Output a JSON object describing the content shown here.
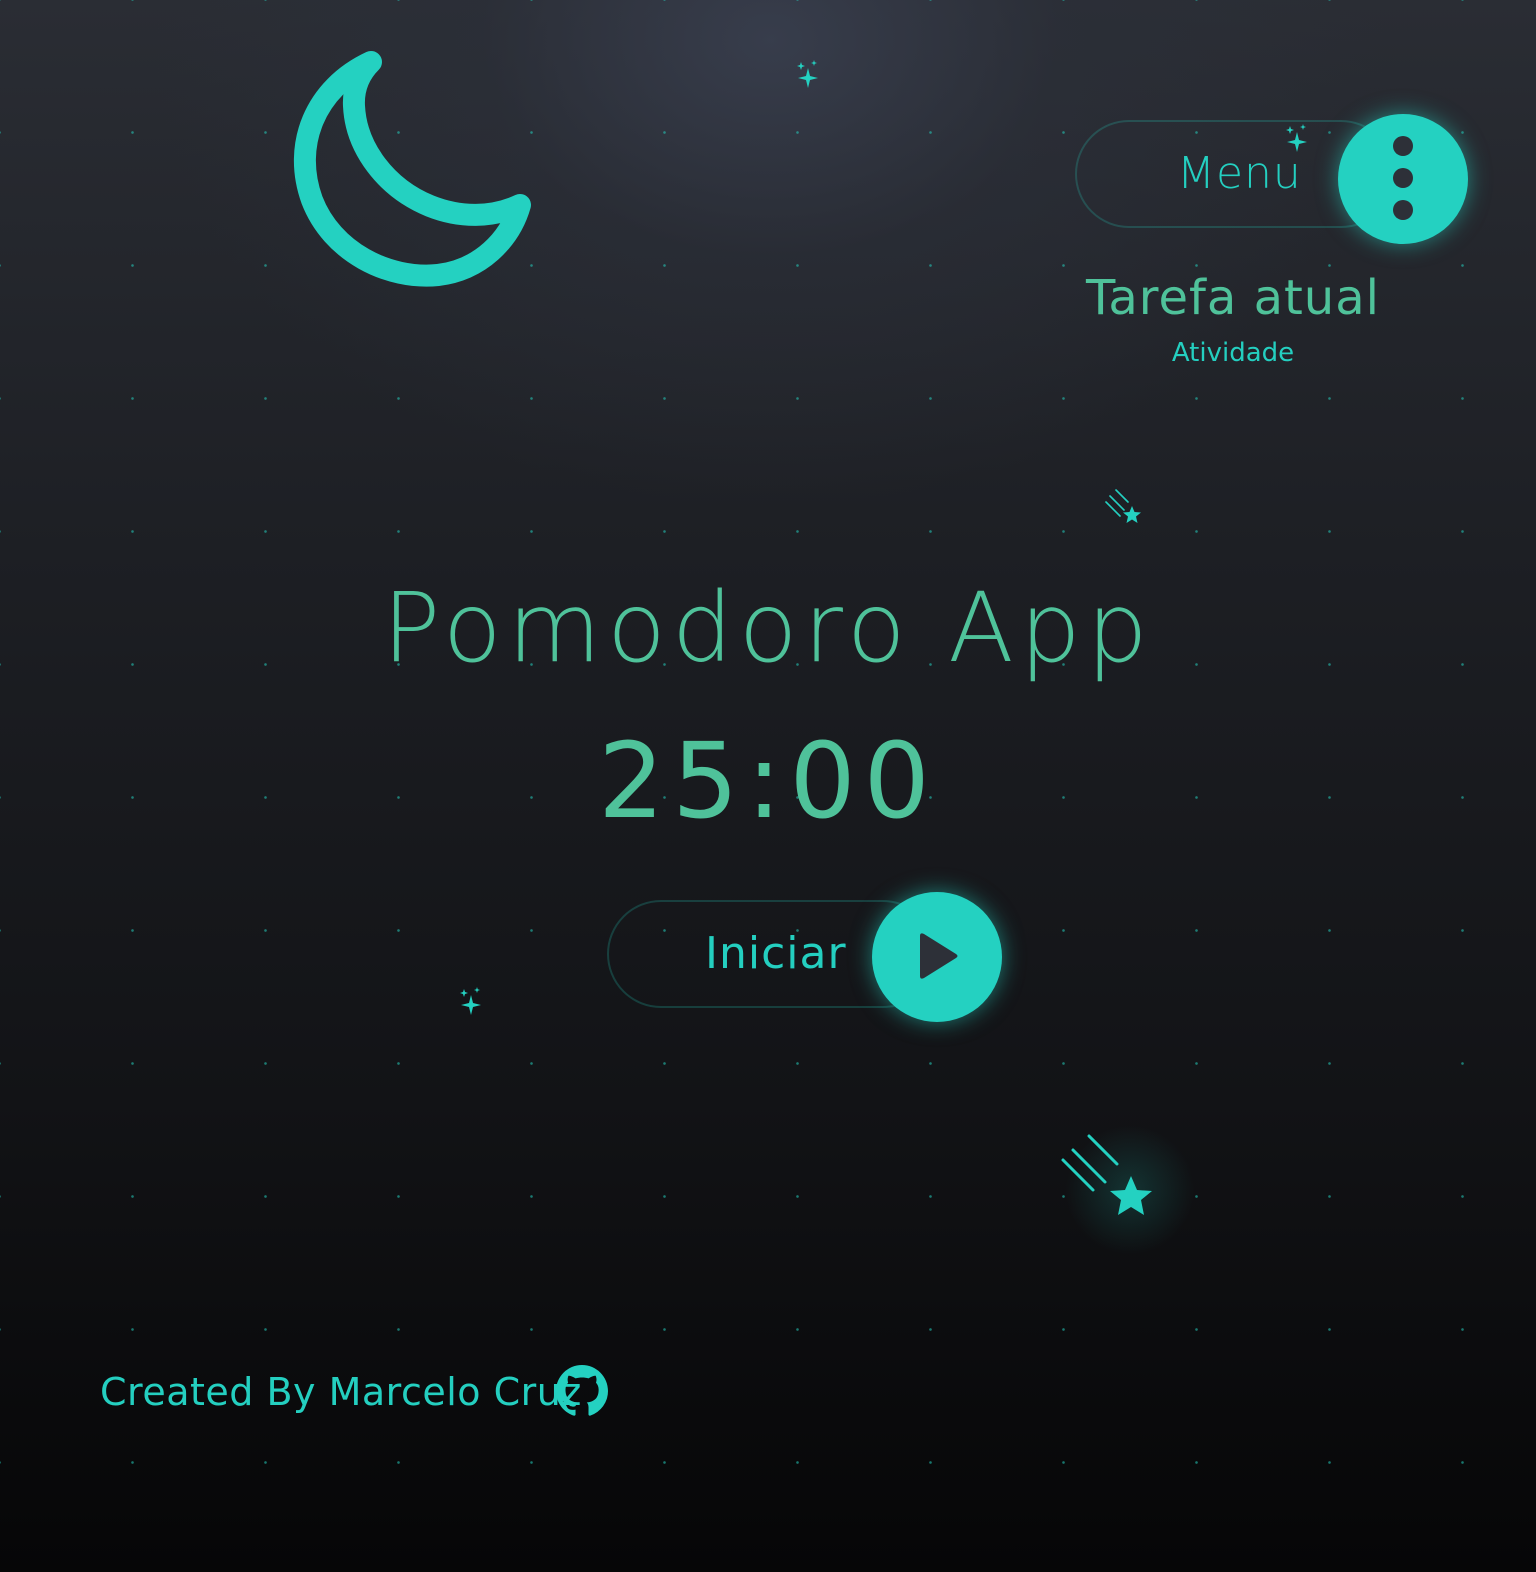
{
  "theme": {
    "accent": "#24d1c1",
    "text_green": "#4fc29a",
    "dark_icon": "#2d3038"
  },
  "header": {
    "theme_icon": "moon-icon",
    "menu": {
      "label": "Menu",
      "icon": "kebab-menu-icon"
    },
    "current_task": {
      "title": "Tarefa atual",
      "subtitle": "Atividade"
    }
  },
  "main": {
    "title": "Pomodoro App",
    "timer": "25:00",
    "start": {
      "label": "Iniciar",
      "icon": "play-icon"
    }
  },
  "footer": {
    "credit": "Created By Marcelo Cruz",
    "icon": "github-icon"
  },
  "decorations": [
    "sparkle-icon",
    "shooting-star-icon"
  ]
}
